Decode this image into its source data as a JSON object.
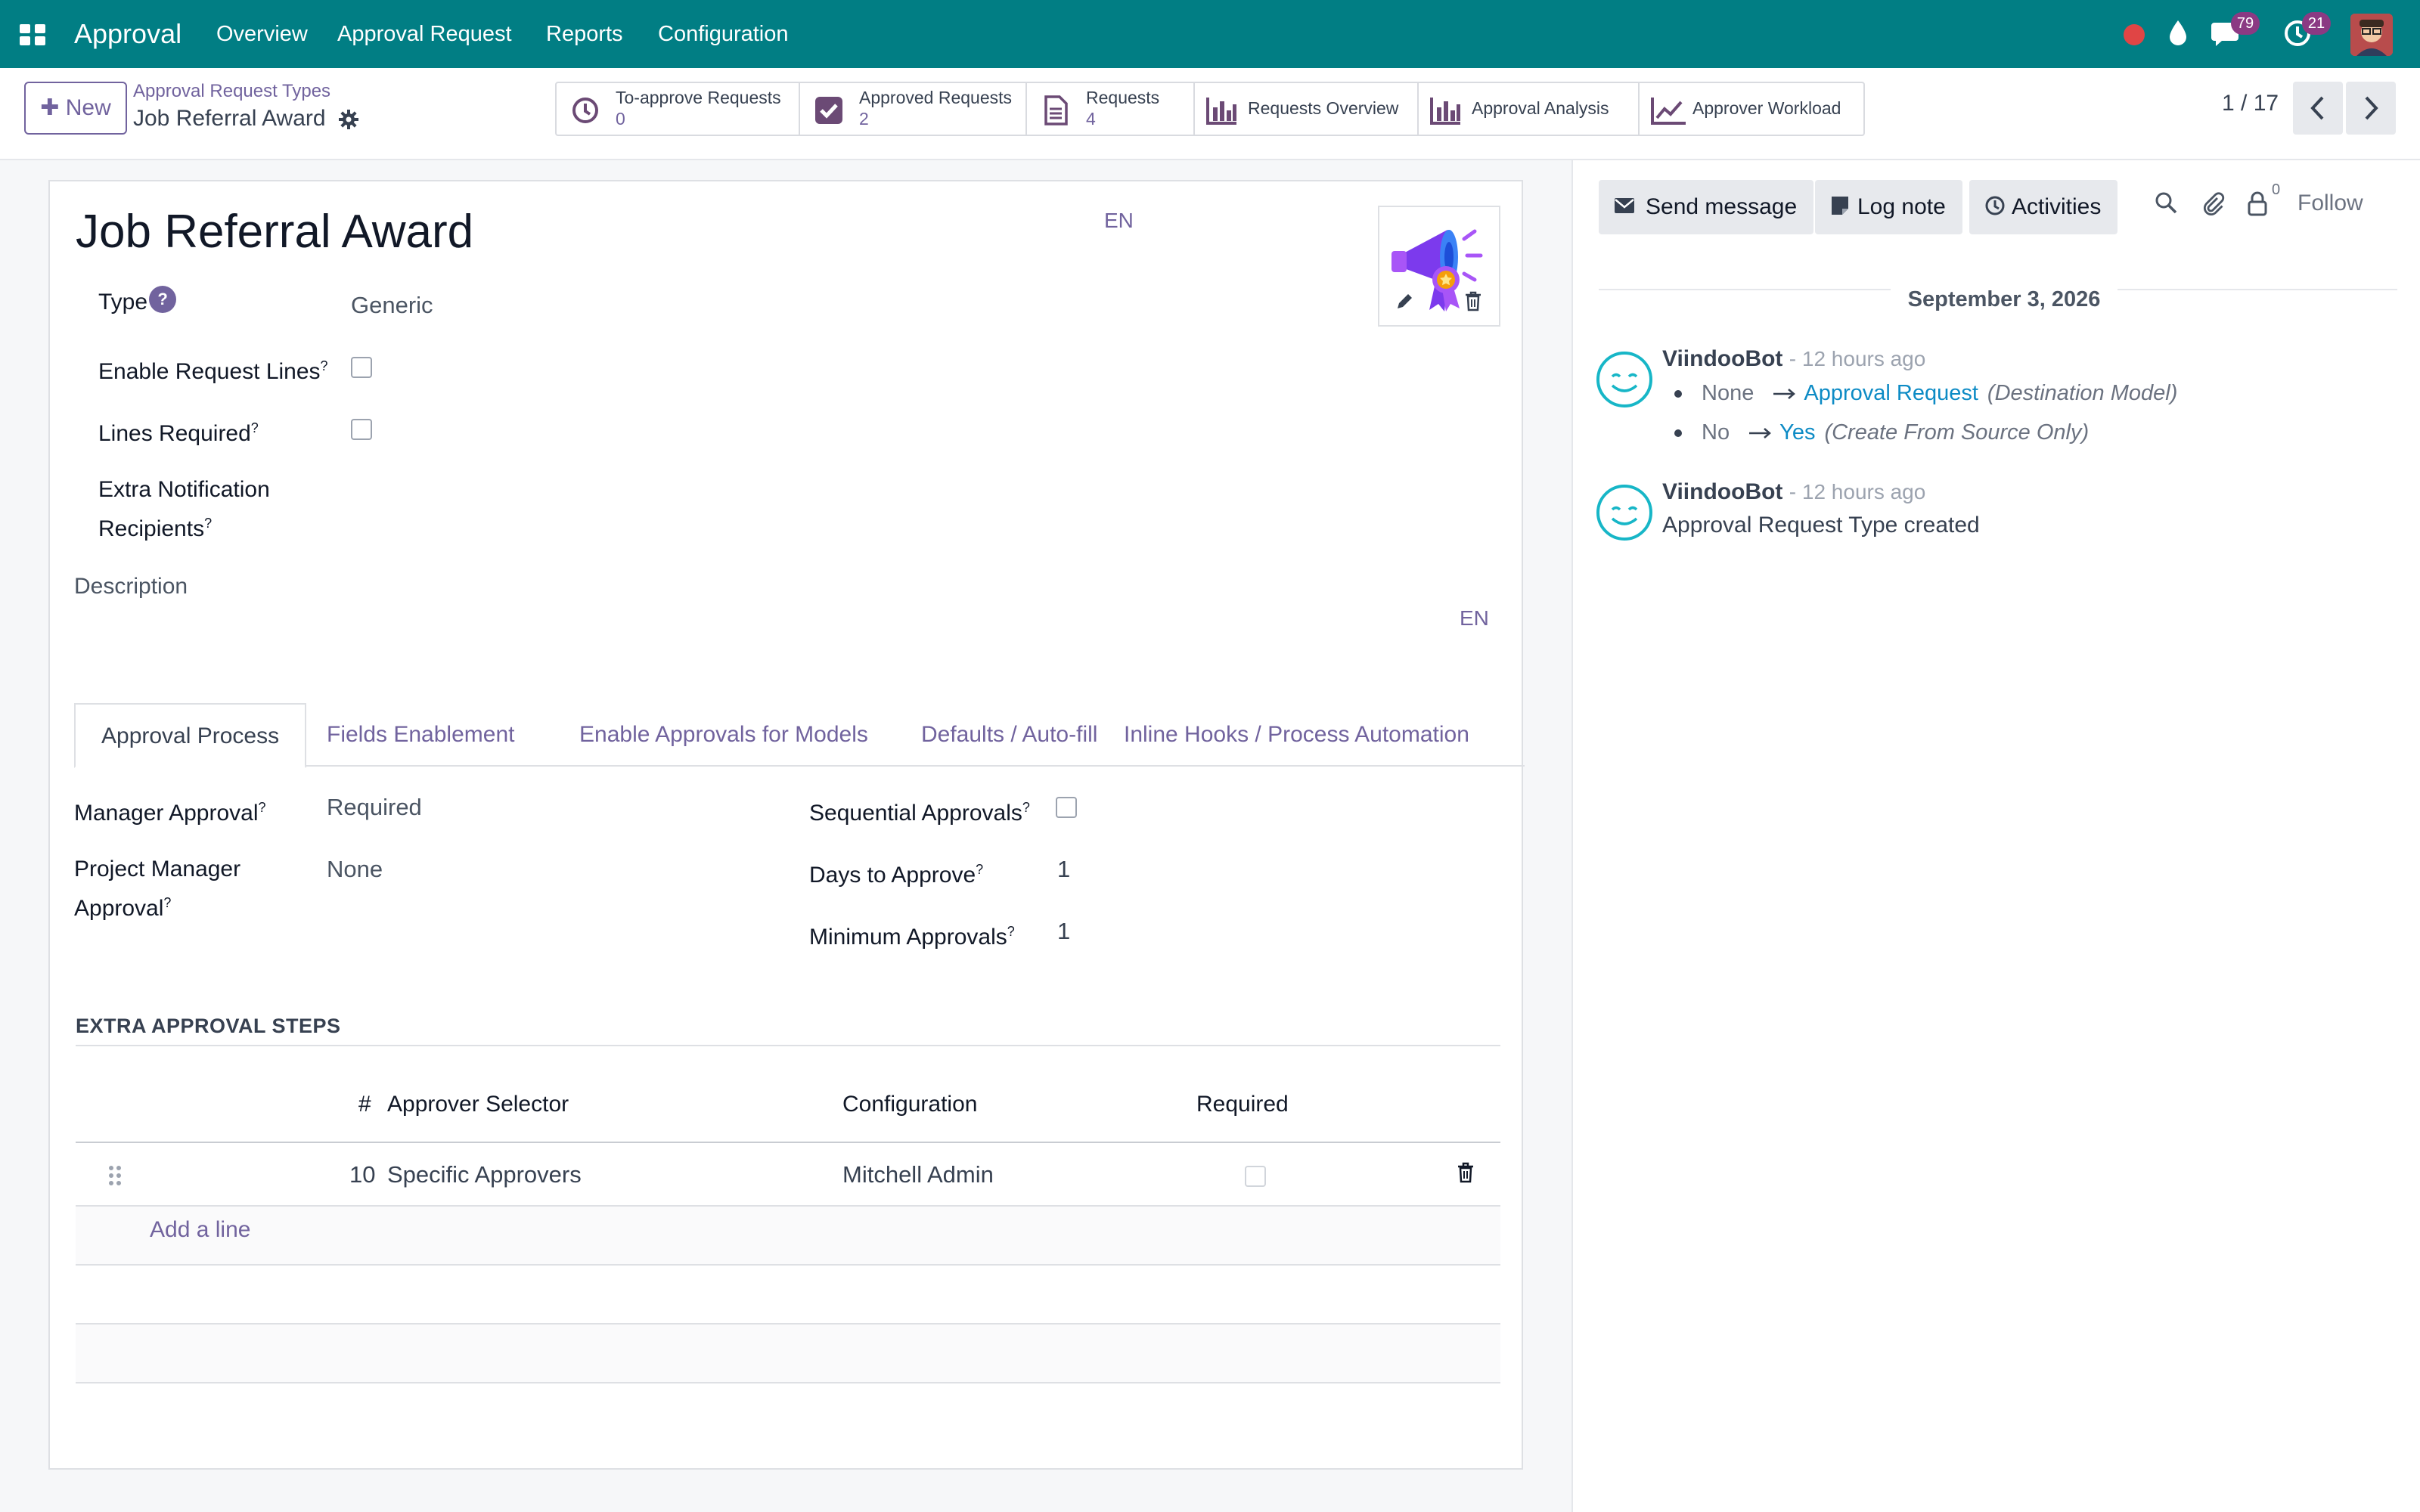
{
  "nav": {
    "app_name": "Approval",
    "menu": [
      "Overview",
      "Approval Request",
      "Reports",
      "Configuration"
    ],
    "messages_count": "79",
    "activities_count": "21"
  },
  "control_panel": {
    "new_label": "New",
    "breadcrumb_parent": "Approval Request Types",
    "breadcrumb_current": "Job Referral Award",
    "smart_buttons": [
      {
        "label": "To-approve Requests",
        "value": "0",
        "icon": "clock-icon"
      },
      {
        "label": "Approved Requests",
        "value": "2",
        "icon": "checkbox-icon"
      },
      {
        "label": "Requests",
        "value": "4",
        "icon": "document-icon"
      },
      {
        "label": "Requests Overview",
        "icon": "bar-chart-icon"
      },
      {
        "label": "Approval Analysis",
        "icon": "bar-chart-icon"
      },
      {
        "label": "Approver Workload",
        "icon": "line-chart-icon"
      }
    ],
    "pager": "1 / 17"
  },
  "form": {
    "title": "Job Referral Award",
    "lang": "EN",
    "type_label": "Type",
    "type_help": "?",
    "type_value": "Generic",
    "enable_lines_label": "Enable Request Lines",
    "lines_required_label": "Lines Required",
    "extra_notif_label_1": "Extra Notification",
    "extra_notif_label_2": "Recipients",
    "description_label": "Description",
    "description_lang": "EN",
    "help_mark": "?",
    "tabs": [
      "Approval Process",
      "Fields Enablement",
      "Enable Approvals for Models",
      "Defaults / Auto-fill",
      "Inline Hooks / Process Automation"
    ],
    "manager_approval_label": "Manager Approval",
    "manager_approval_value": "Required",
    "pm_approval_label_1": "Project Manager",
    "pm_approval_label_2": "Approval",
    "pm_approval_value": "None",
    "sequential_label": "Sequential Approvals",
    "days_label": "Days to Approve",
    "days_value": "1",
    "min_label": "Minimum Approvals",
    "min_value": "1",
    "steps_title": "EXTRA APPROVAL STEPS",
    "columns": {
      "seq": "#",
      "selector": "Approver Selector",
      "config": "Configuration",
      "required": "Required"
    },
    "row": {
      "seq": "10",
      "selector": "Specific Approvers",
      "config": "Mitchell Admin"
    },
    "add_line": "Add a line"
  },
  "chatter": {
    "send_message": "Send message",
    "log_note": "Log note",
    "activities": "Activities",
    "followers_count": "0",
    "follow": "Follow",
    "date": "September 3, 2026",
    "messages": [
      {
        "author": "ViindooBot",
        "time": "- 12 hours ago",
        "tracking": [
          {
            "old": "None",
            "new": "Approval Request",
            "field": "(Destination Model)"
          },
          {
            "old": "No",
            "new": "Yes",
            "field": "(Create From Source Only)"
          }
        ]
      },
      {
        "author": "ViindooBot",
        "time": "- 12 hours ago",
        "body": "Approval Request Type created"
      }
    ]
  }
}
